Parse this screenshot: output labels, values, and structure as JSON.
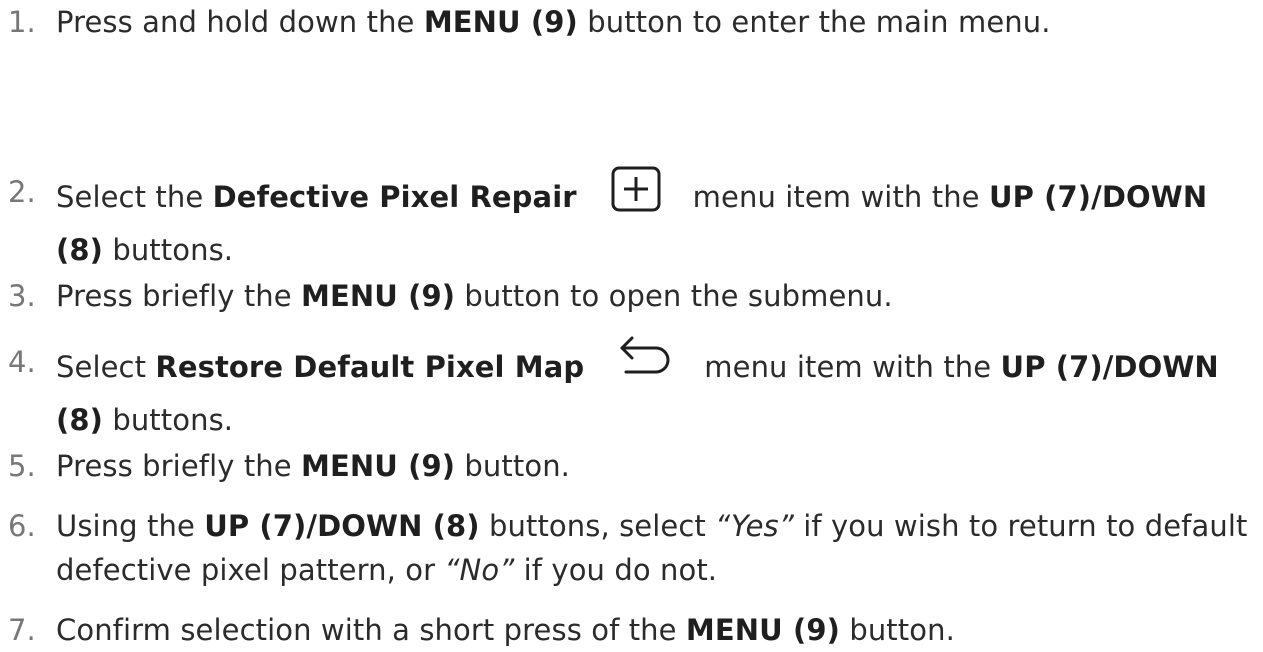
{
  "steps": [
    {
      "num": "1.",
      "parts": [
        "Press and hold down the ",
        "MENU (9)",
        " button to enter the main menu."
      ]
    },
    {
      "num": "2.",
      "parts": [
        "Select the ",
        "Defective Pixel Repair",
        "menu item with the ",
        "UP (7)/DOWN",
        "(8)",
        " buttons."
      ],
      "icon": "add-square-icon"
    },
    {
      "num": "3.",
      "parts": [
        "Press briefly the ",
        "MENU (9)",
        " button to open the submenu."
      ]
    },
    {
      "num": "4.",
      "parts": [
        "Select ",
        "Restore Default Pixel Map",
        "menu item with the ",
        "UP (7)/DOWN",
        "(8)",
        " buttons."
      ],
      "icon": "return-arrow-icon"
    },
    {
      "num": "5.",
      "parts": [
        "Press briefly the ",
        "MENU (9)",
        " button."
      ]
    },
    {
      "num": "6.",
      "parts": [
        "Using the ",
        "UP (7)/DOWN (8)",
        " buttons, select ",
        "“Yes”",
        " if you wish to return to default",
        "defective pixel pattern, or ",
        "“No”",
        " if you do not."
      ]
    },
    {
      "num": "7.",
      "parts": [
        "Confirm selection with a short press of the ",
        "MENU (9)",
        " button."
      ]
    }
  ]
}
